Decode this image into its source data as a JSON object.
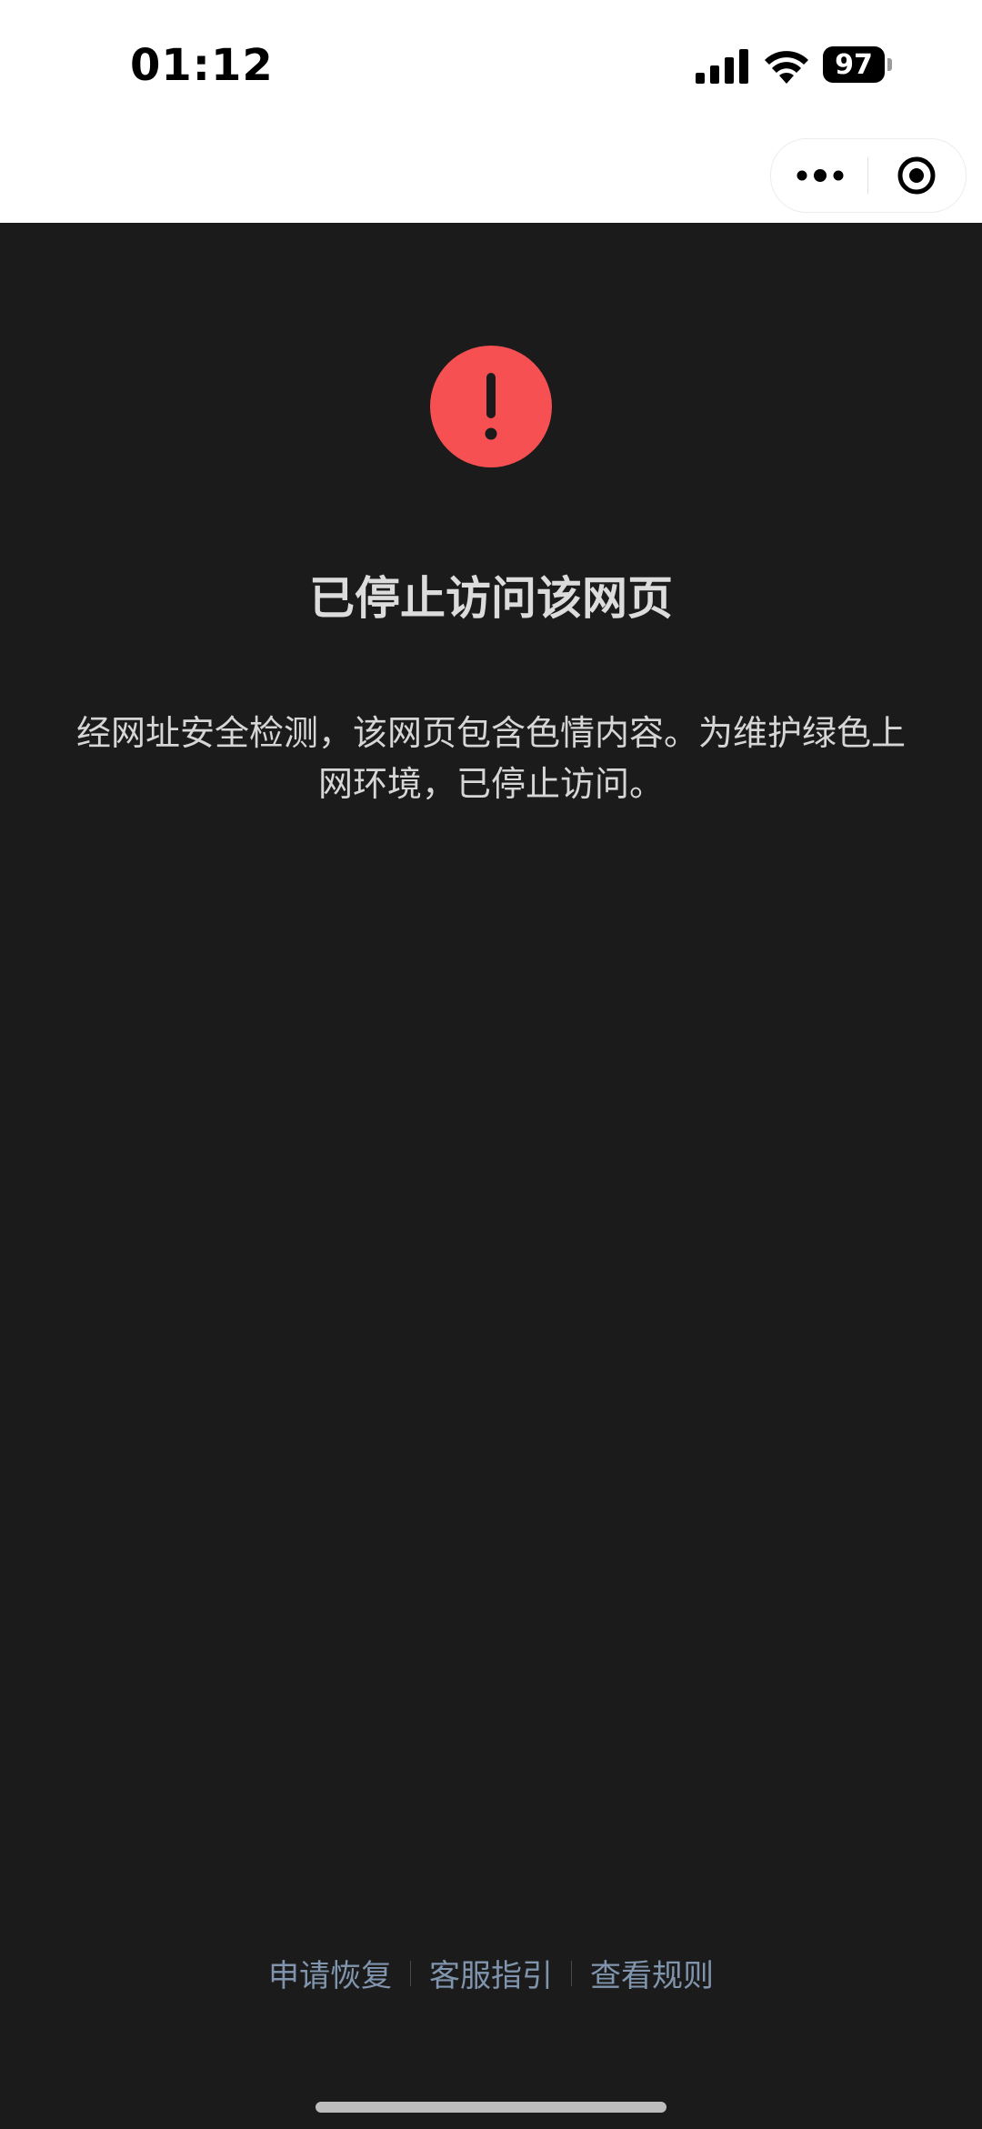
{
  "status_bar": {
    "time": "01:12",
    "battery_level": "97",
    "icons": [
      "signal-icon",
      "wifi-icon",
      "battery-icon"
    ]
  },
  "nav_bar": {
    "icons": [
      "more-icon",
      "close-target-icon"
    ]
  },
  "content": {
    "icon": "warning-icon",
    "accent_color": "#f65053",
    "title": "已停止访问该网页",
    "message": "经网址安全检测，该网页包含色情内容。为维护绿色上网环境，已停止访问。"
  },
  "footer": {
    "links": [
      {
        "label": "申请恢复"
      },
      {
        "label": "客服指引"
      },
      {
        "label": "查看规则"
      }
    ],
    "link_color": "#8095ad"
  },
  "colors": {
    "background": "#1b1b1b",
    "header": "#ffffff"
  }
}
